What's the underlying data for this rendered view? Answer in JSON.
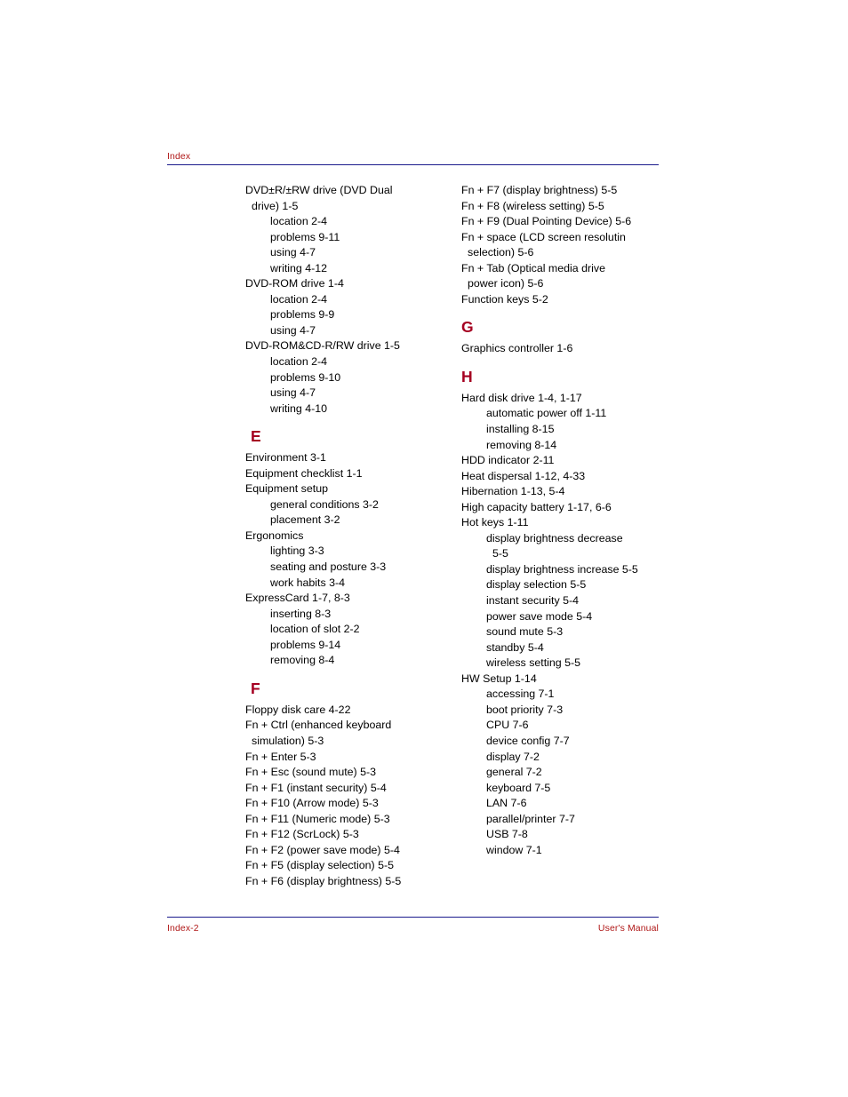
{
  "header": {
    "label": "Index",
    "rule_color": "#1a1a8c"
  },
  "theme": {
    "header_text_color": "#b01818",
    "letter_color": "#a50021",
    "body_text_color": "#000000",
    "page_background": "#ffffff"
  },
  "footer": {
    "page_number": "Index-2",
    "manual_label": "User's Manual"
  },
  "left_column": [
    {
      "type": "entry",
      "level": 0,
      "text": "DVD±R/±RW drive (DVD Dual"
    },
    {
      "type": "entry",
      "level": 0,
      "wrap": true,
      "text": "drive) 1-5"
    },
    {
      "type": "entry",
      "level": 1,
      "text": "location 2-4"
    },
    {
      "type": "entry",
      "level": 1,
      "text": "problems 9-11"
    },
    {
      "type": "entry",
      "level": 1,
      "text": "using 4-7"
    },
    {
      "type": "entry",
      "level": 1,
      "text": "writing 4-12"
    },
    {
      "type": "entry",
      "level": 0,
      "text": "DVD-ROM drive 1-4"
    },
    {
      "type": "entry",
      "level": 1,
      "text": "location 2-4"
    },
    {
      "type": "entry",
      "level": 1,
      "text": "problems 9-9"
    },
    {
      "type": "entry",
      "level": 1,
      "text": "using 4-7"
    },
    {
      "type": "entry",
      "level": 0,
      "text": "DVD-ROM&CD-R/RW drive 1-5"
    },
    {
      "type": "entry",
      "level": 1,
      "text": "location 2-4"
    },
    {
      "type": "entry",
      "level": 1,
      "text": "problems 9-10"
    },
    {
      "type": "entry",
      "level": 1,
      "text": "using 4-7"
    },
    {
      "type": "entry",
      "level": 1,
      "text": "writing 4-10"
    },
    {
      "type": "letter",
      "text": "E"
    },
    {
      "type": "entry",
      "level": 0,
      "text": "Environment 3-1"
    },
    {
      "type": "entry",
      "level": 0,
      "text": "Equipment checklist 1-1"
    },
    {
      "type": "entry",
      "level": 0,
      "text": "Equipment setup"
    },
    {
      "type": "entry",
      "level": 1,
      "text": "general conditions 3-2"
    },
    {
      "type": "entry",
      "level": 1,
      "text": "placement 3-2"
    },
    {
      "type": "entry",
      "level": 0,
      "text": "Ergonomics"
    },
    {
      "type": "entry",
      "level": 1,
      "text": "lighting 3-3"
    },
    {
      "type": "entry",
      "level": 1,
      "text": "seating and posture 3-3"
    },
    {
      "type": "entry",
      "level": 1,
      "text": "work habits 3-4"
    },
    {
      "type": "entry",
      "level": 0,
      "text": "ExpressCard 1-7, 8-3"
    },
    {
      "type": "entry",
      "level": 1,
      "text": "inserting 8-3"
    },
    {
      "type": "entry",
      "level": 1,
      "text": "location of slot 2-2"
    },
    {
      "type": "entry",
      "level": 1,
      "text": "problems 9-14"
    },
    {
      "type": "entry",
      "level": 1,
      "text": "removing 8-4"
    },
    {
      "type": "letter",
      "text": "F"
    },
    {
      "type": "entry",
      "level": 0,
      "text": "Floppy disk care 4-22"
    },
    {
      "type": "entry",
      "level": 0,
      "text": "Fn + Ctrl (enhanced keyboard"
    },
    {
      "type": "entry",
      "level": 0,
      "wrap": true,
      "text": "simulation) 5-3"
    },
    {
      "type": "entry",
      "level": 0,
      "text": "Fn + Enter 5-3"
    },
    {
      "type": "entry",
      "level": 0,
      "text": "Fn + Esc (sound mute) 5-3"
    },
    {
      "type": "entry",
      "level": 0,
      "text": "Fn + F1 (instant security) 5-4"
    },
    {
      "type": "entry",
      "level": 0,
      "text": "Fn + F10 (Arrow mode) 5-3"
    },
    {
      "type": "entry",
      "level": 0,
      "text": "Fn + F11 (Numeric mode) 5-3"
    },
    {
      "type": "entry",
      "level": 0,
      "text": "Fn + F12 (ScrLock) 5-3"
    },
    {
      "type": "entry",
      "level": 0,
      "text": "Fn + F2 (power save mode) 5-4"
    },
    {
      "type": "entry",
      "level": 0,
      "text": "Fn + F5 (display selection) 5-5"
    },
    {
      "type": "entry",
      "level": 0,
      "text": "Fn + F6 (display brightness) 5-5"
    }
  ],
  "right_column": [
    {
      "type": "entry",
      "level": 0,
      "text": "Fn + F7 (display brightness) 5-5"
    },
    {
      "type": "entry",
      "level": 0,
      "text": "Fn + F8 (wireless setting) 5-5"
    },
    {
      "type": "entry",
      "level": 0,
      "text": "Fn + F9 (Dual Pointing Device) 5-6"
    },
    {
      "type": "entry",
      "level": 0,
      "text": "Fn + space (LCD screen resolutin"
    },
    {
      "type": "entry",
      "level": 0,
      "wrap": true,
      "text": "selection) 5-6"
    },
    {
      "type": "entry",
      "level": 0,
      "text": "Fn + Tab (Optical media drive"
    },
    {
      "type": "entry",
      "level": 0,
      "wrap": true,
      "text": "power icon) 5-6"
    },
    {
      "type": "entry",
      "level": 0,
      "text": "Function keys 5-2"
    },
    {
      "type": "letter",
      "text": "G"
    },
    {
      "type": "entry",
      "level": 0,
      "text": "Graphics controller 1-6"
    },
    {
      "type": "letter",
      "text": "H"
    },
    {
      "type": "entry",
      "level": 0,
      "text": "Hard disk drive 1-4, 1-17"
    },
    {
      "type": "entry",
      "level": 1,
      "text": "automatic power off 1-11"
    },
    {
      "type": "entry",
      "level": 1,
      "text": "installing 8-15"
    },
    {
      "type": "entry",
      "level": 1,
      "text": "removing 8-14"
    },
    {
      "type": "entry",
      "level": 0,
      "text": "HDD indicator 2-11"
    },
    {
      "type": "entry",
      "level": 0,
      "text": "Heat dispersal 1-12, 4-33"
    },
    {
      "type": "entry",
      "level": 0,
      "text": "Hibernation 1-13, 5-4"
    },
    {
      "type": "entry",
      "level": 0,
      "text": "High capacity battery 1-17, 6-6"
    },
    {
      "type": "entry",
      "level": 0,
      "text": "Hot keys 1-11"
    },
    {
      "type": "entry",
      "level": 1,
      "text": "display brightness decrease"
    },
    {
      "type": "entry",
      "level": 1,
      "wrap": true,
      "text": "5-5"
    },
    {
      "type": "entry",
      "level": 1,
      "text": "display brightness increase 5-5"
    },
    {
      "type": "entry",
      "level": 1,
      "text": "display selection 5-5"
    },
    {
      "type": "entry",
      "level": 1,
      "text": "instant security 5-4"
    },
    {
      "type": "entry",
      "level": 1,
      "text": "power save mode 5-4"
    },
    {
      "type": "entry",
      "level": 1,
      "text": "sound mute 5-3"
    },
    {
      "type": "entry",
      "level": 1,
      "text": "standby 5-4"
    },
    {
      "type": "entry",
      "level": 1,
      "text": "wireless setting 5-5"
    },
    {
      "type": "entry",
      "level": 0,
      "text": "HW Setup 1-14"
    },
    {
      "type": "entry",
      "level": 1,
      "text": "accessing 7-1"
    },
    {
      "type": "entry",
      "level": 1,
      "text": "boot priority 7-3"
    },
    {
      "type": "entry",
      "level": 1,
      "text": "CPU 7-6"
    },
    {
      "type": "entry",
      "level": 1,
      "text": "device config 7-7"
    },
    {
      "type": "entry",
      "level": 1,
      "text": "display 7-2"
    },
    {
      "type": "entry",
      "level": 1,
      "text": "general 7-2"
    },
    {
      "type": "entry",
      "level": 1,
      "text": "keyboard 7-5"
    },
    {
      "type": "entry",
      "level": 1,
      "text": "LAN 7-6"
    },
    {
      "type": "entry",
      "level": 1,
      "text": "parallel/printer 7-7"
    },
    {
      "type": "entry",
      "level": 1,
      "text": "USB 7-8"
    },
    {
      "type": "entry",
      "level": 1,
      "text": "window 7-1"
    }
  ]
}
